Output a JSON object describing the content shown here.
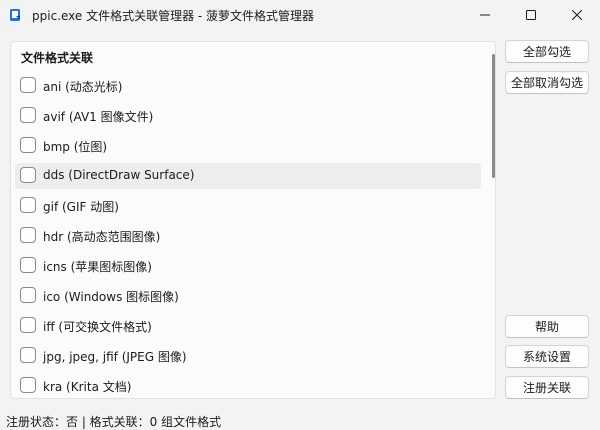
{
  "window": {
    "title": "ppic.exe 文件格式关联管理器 - 菠萝文件格式管理器",
    "app_icon": "app-icon",
    "controls": [
      "minimize-icon",
      "maximize-icon",
      "close-icon"
    ]
  },
  "panel": {
    "header": "文件格式关联",
    "items": [
      {
        "label": "ani (动态光标)",
        "checked": false
      },
      {
        "label": "avif (AV1 图像文件)",
        "checked": false
      },
      {
        "label": "bmp (位图)",
        "checked": false
      },
      {
        "label": "dds (DirectDraw Surface)",
        "checked": false
      },
      {
        "label": "gif (GIF 动图)",
        "checked": false
      },
      {
        "label": "hdr (高动态范围图像)",
        "checked": false
      },
      {
        "label": "icns (苹果图标图像)",
        "checked": false
      },
      {
        "label": "ico (Windows 图标图像)",
        "checked": false
      },
      {
        "label": "iff (可交换文件格式)",
        "checked": false
      },
      {
        "label": "jpg, jpeg, jfif (JPEG 图像)",
        "checked": false
      },
      {
        "label": "kra (Krita 文档)",
        "checked": false
      }
    ]
  },
  "buttons": {
    "select_all": "全部勾选",
    "deselect_all": "全部取消勾选",
    "help": "帮助",
    "settings": "系统设置",
    "register": "注册关联"
  },
  "status": {
    "text": "注册状态：否 | 格式关联：0 组文件格式"
  },
  "colors": {
    "window_bg": "#f3f3f3",
    "panel_bg": "#fbfbfb",
    "accent": "#0f6cbd"
  }
}
